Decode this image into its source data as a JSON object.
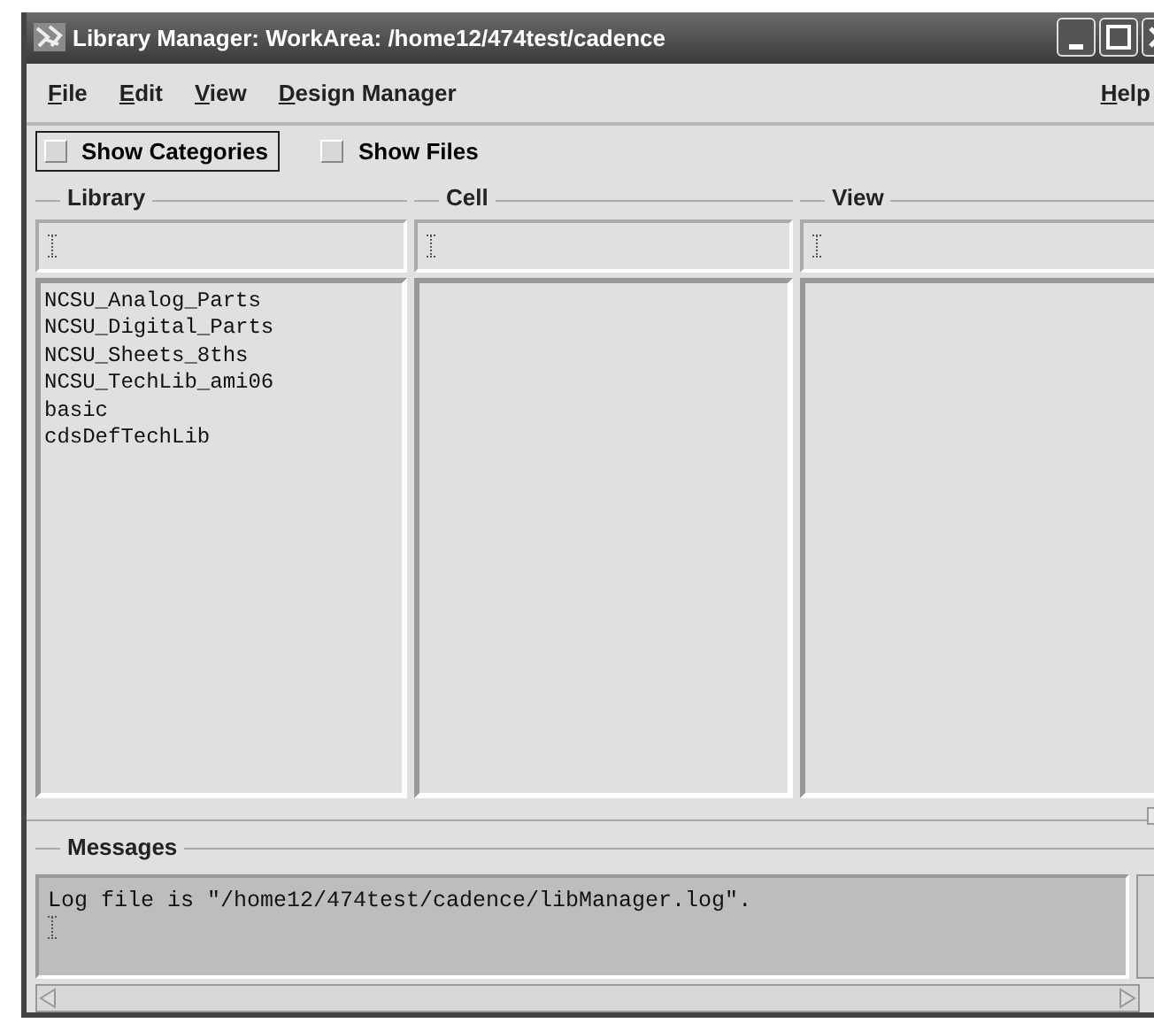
{
  "window": {
    "title": "Library Manager: WorkArea: /home12/474test/cadence"
  },
  "menu": {
    "items": [
      "File",
      "Edit",
      "View",
      "Design Manager"
    ],
    "right_items": [
      "Help"
    ]
  },
  "options": [
    {
      "label": "Show Categories",
      "checked": false,
      "focused": true
    },
    {
      "label": "Show Files",
      "checked": false,
      "focused": false
    }
  ],
  "columns": [
    {
      "label": "Library",
      "items": [
        "NCSU_Analog_Parts",
        "NCSU_Digital_Parts",
        "NCSU_Sheets_8ths",
        "NCSU_TechLib_ami06",
        "basic",
        "cdsDefTechLib"
      ]
    },
    {
      "label": "Cell"
    },
    {
      "label": "View"
    }
  ],
  "messages": {
    "label": "Messages",
    "lines": [
      "Log file is \"/home12/474test/cadence/libManager.log\"."
    ]
  }
}
